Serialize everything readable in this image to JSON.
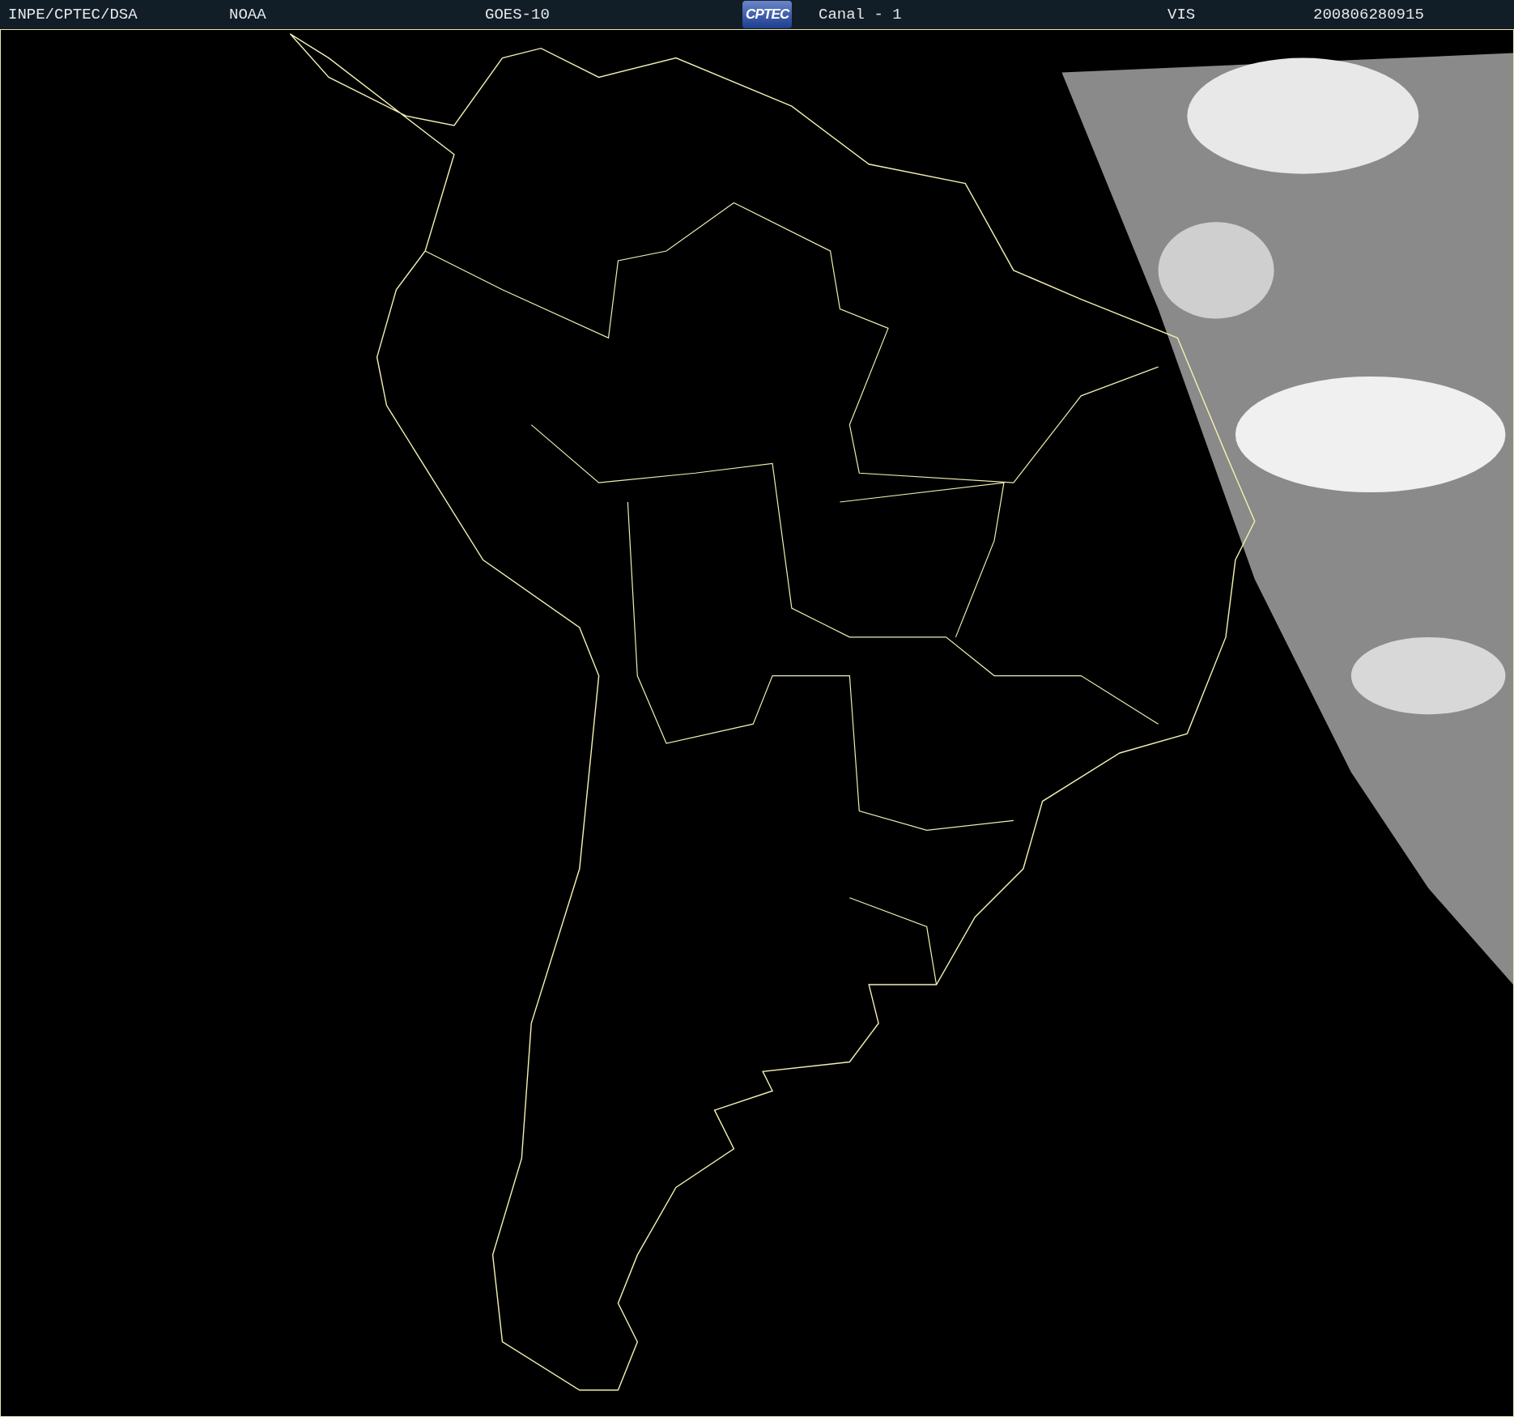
{
  "header": {
    "items": [
      {
        "kind": "text",
        "text": "INPE/CPTEC/DSA"
      },
      {
        "kind": "text",
        "text": "NOAA"
      },
      {
        "kind": "text",
        "text": "GOES-10"
      },
      {
        "kind": "logo",
        "text": "CPTEC"
      },
      {
        "kind": "text",
        "text": "Canal - 1"
      },
      {
        "kind": "text",
        "text": "VIS"
      },
      {
        "kind": "text",
        "text": "200806280915"
      }
    ]
  }
}
